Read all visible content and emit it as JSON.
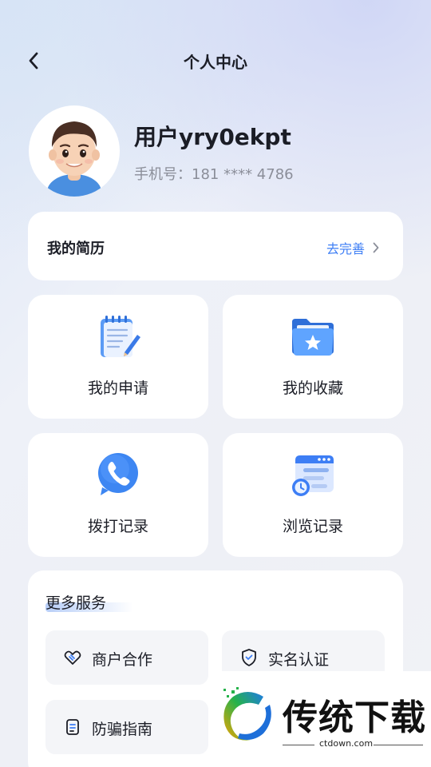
{
  "header": {
    "title": "个人中心"
  },
  "profile": {
    "username": "用户yry0ekpt",
    "phone": "手机号：181 **** 4786"
  },
  "resume": {
    "title": "我的简历",
    "action": "去完善"
  },
  "tiles": [
    {
      "label": "我的申请",
      "icon": "notepad-icon"
    },
    {
      "label": "我的收藏",
      "icon": "star-folder-icon"
    },
    {
      "label": "拨打记录",
      "icon": "phone-call-icon"
    },
    {
      "label": "浏览记录",
      "icon": "browser-history-icon"
    }
  ],
  "services": {
    "title": "更多服务",
    "items": [
      {
        "label": "商户合作",
        "icon": "handshake-icon"
      },
      {
        "label": "实名认证",
        "icon": "shield-check-icon"
      },
      {
        "label": "防骗指南",
        "icon": "guide-doc-icon"
      }
    ]
  },
  "watermark": {
    "brand": "传统下载",
    "url": "ctdown.com"
  },
  "colors": {
    "accent": "#3d7ef5",
    "background": "#eef1f8",
    "card": "#ffffff",
    "text": "#1b1d26",
    "muted": "#8b8e99"
  }
}
